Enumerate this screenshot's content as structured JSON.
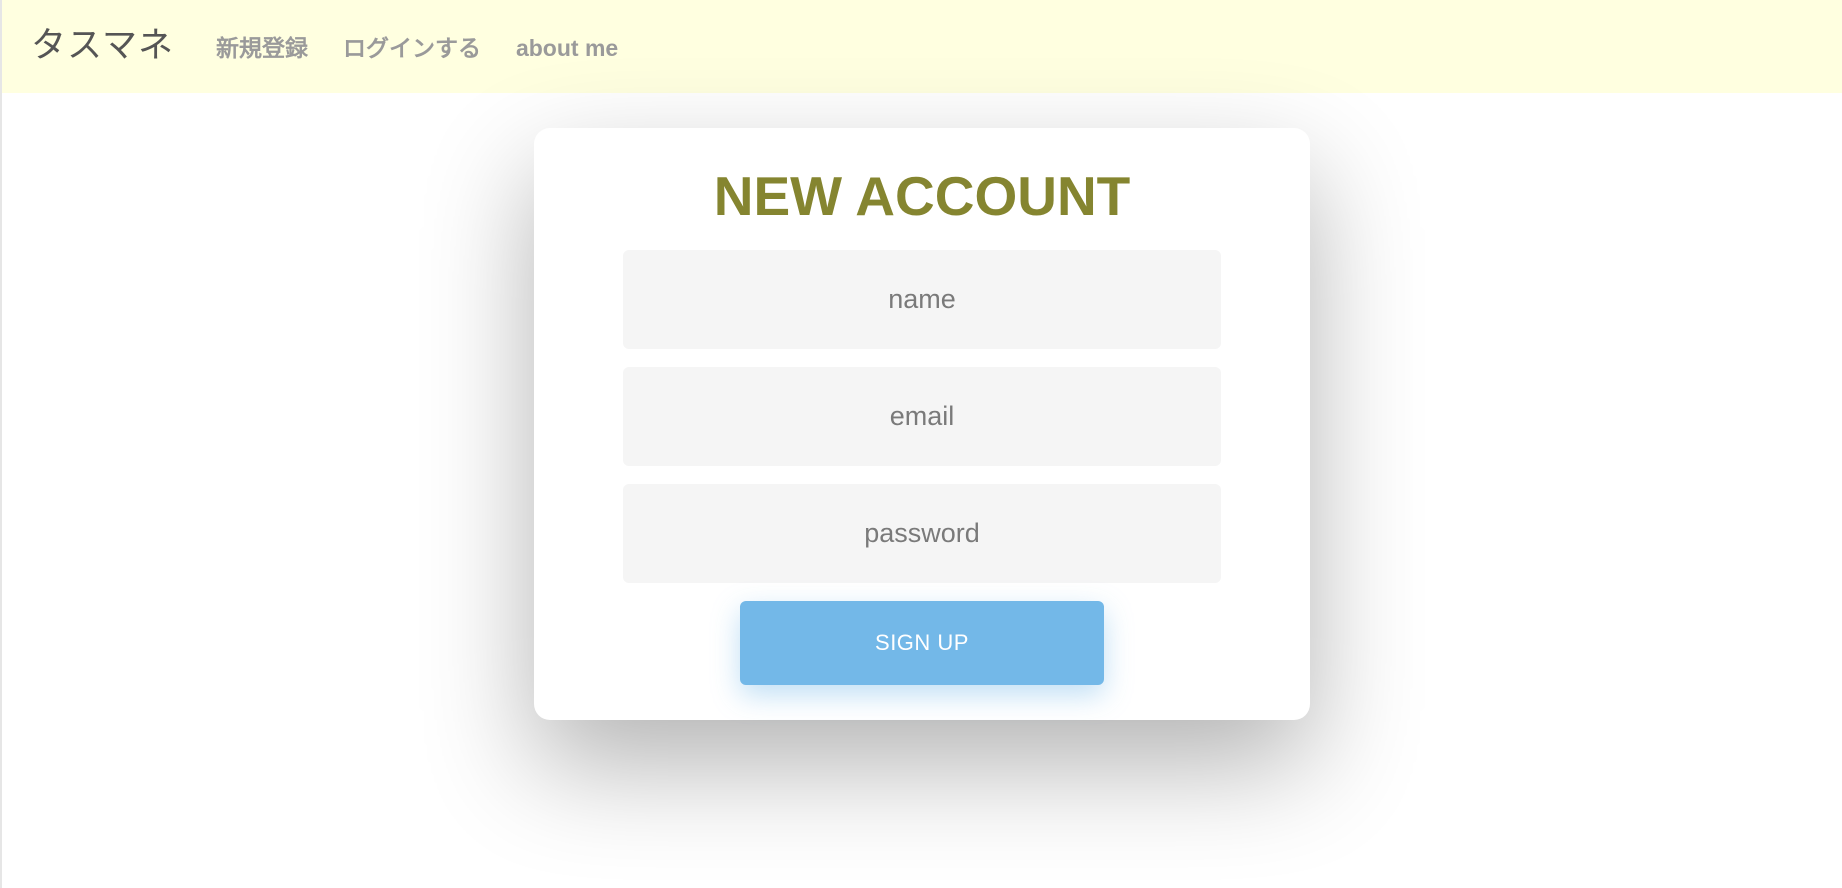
{
  "navbar": {
    "brand": "タスマネ",
    "links": [
      {
        "label": "新規登録"
      },
      {
        "label": "ログインする"
      },
      {
        "label": "about me"
      }
    ],
    "background_color": "#ffffe0"
  },
  "form": {
    "title": "NEW ACCOUNT",
    "title_color": "#858530",
    "fields": {
      "name": {
        "value": "",
        "placeholder": "name"
      },
      "email": {
        "value": "",
        "placeholder": "email"
      },
      "password": {
        "value": "",
        "placeholder": "password"
      }
    },
    "submit_label": "SIGN UP",
    "submit_color": "#73b8e8"
  }
}
